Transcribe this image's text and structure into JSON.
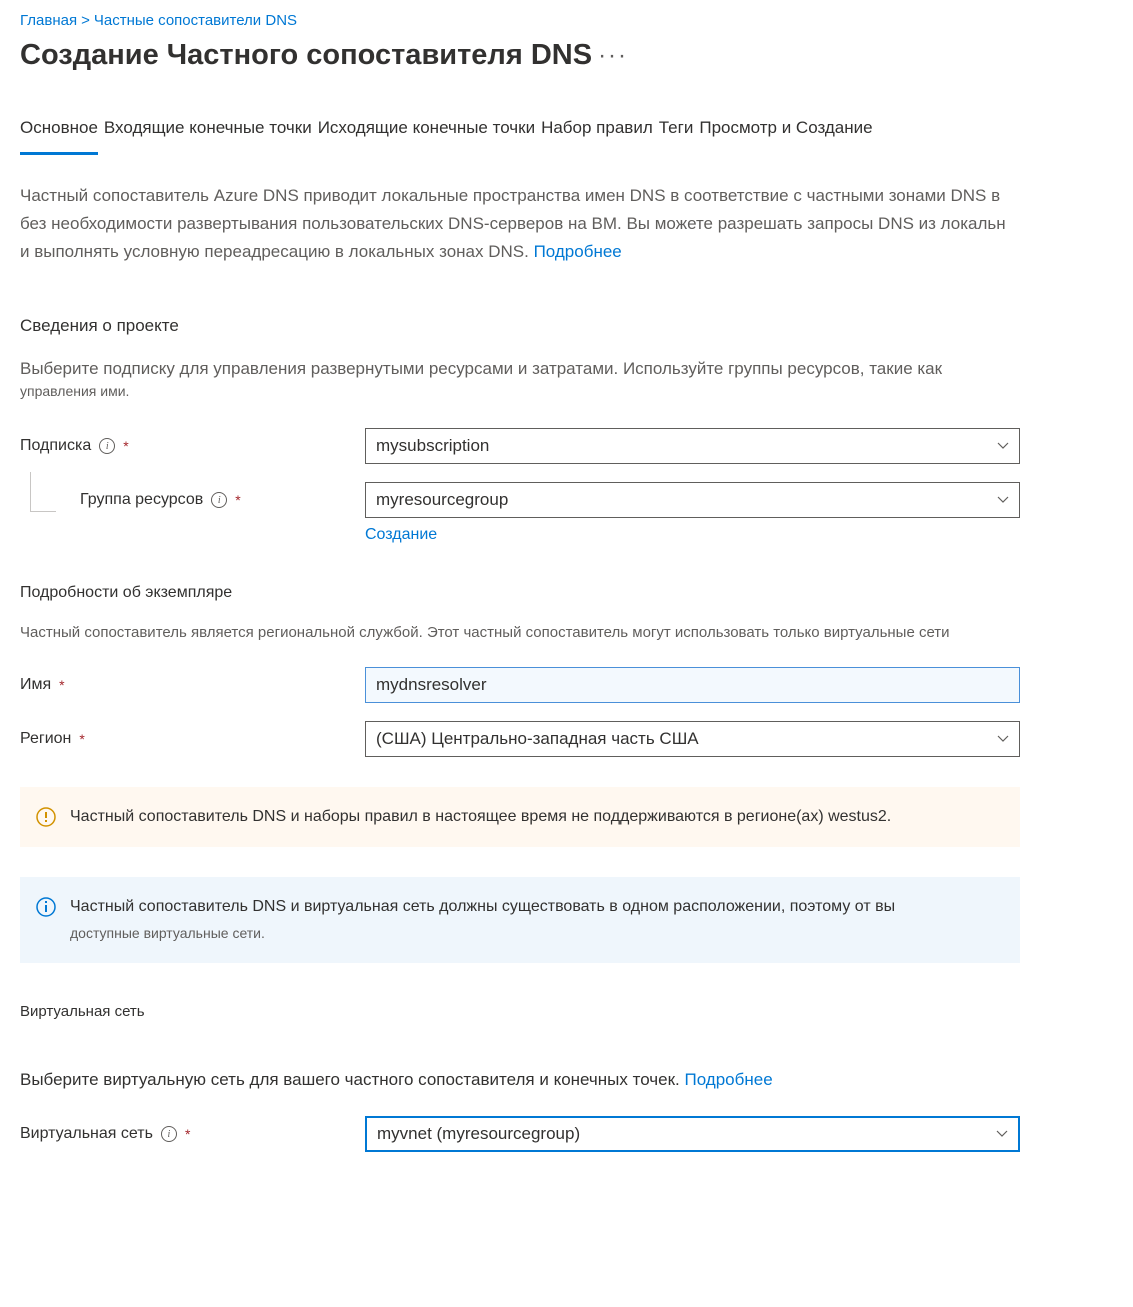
{
  "breadcrumb": {
    "home": "Главная",
    "sep": ">",
    "parent": "Частные сопоставители DNS"
  },
  "page_title": "Создание Частного сопоставителя DNS",
  "tabs": {
    "t0": "Основное",
    "t1": "Входящие конечные точки",
    "t2": "Исходящие конечные точки",
    "t3": "Набор правил",
    "t4": "Теги",
    "t5": "Просмотр и Создание"
  },
  "intro": {
    "line1": "Частный сопоставитель Azure DNS приводит локальные пространства имен DNS в соответствие с частными зонами DNS в ",
    "line2": "без необходимости развертывания пользовательских DNS-серверов на ВМ. Вы можете разрешать запросы DNS из локальн",
    "line3": "и выполнять условную переадресацию в локальных зонах DNS. ",
    "more": "Подробнее"
  },
  "project": {
    "title": "Сведения о проекте",
    "desc": "Выберите подписку для управления развернутыми ресурсами и затратами. Используйте группы ресурсов, такие как",
    "desc_small": "управления ими.",
    "subscription_label": "Подписка",
    "subscription_value": "mysubscription",
    "rg_label": "Группа ресурсов",
    "rg_value": "myresourcegroup",
    "create_new": "Создание"
  },
  "instance": {
    "title": "Подробности об экземпляре",
    "desc": "Частный сопоставитель является региональной службой. Этот частный сопоставитель могут использовать только виртуальные сети",
    "name_label": "Имя",
    "name_value": "mydnsresolver",
    "region_label": "Регион",
    "region_value": "(США) Центрально-западная часть США"
  },
  "alerts": {
    "warning": "Частный сопоставитель DNS и наборы правил в настоящее время не поддерживаются в регионе(ах) westus2.",
    "info_main": "Частный сопоставитель DNS и виртуальная сеть должны существовать в одном расположении, поэтому от вы",
    "info_sub": "доступные виртуальные сети."
  },
  "vnet": {
    "title": "Виртуальная сеть",
    "desc": "Выберите виртуальную сеть для вашего частного сопоставителя и конечных точек. ",
    "more": "Подробнее",
    "label": "Виртуальная сеть",
    "value": "myvnet (myresourcegroup)"
  }
}
